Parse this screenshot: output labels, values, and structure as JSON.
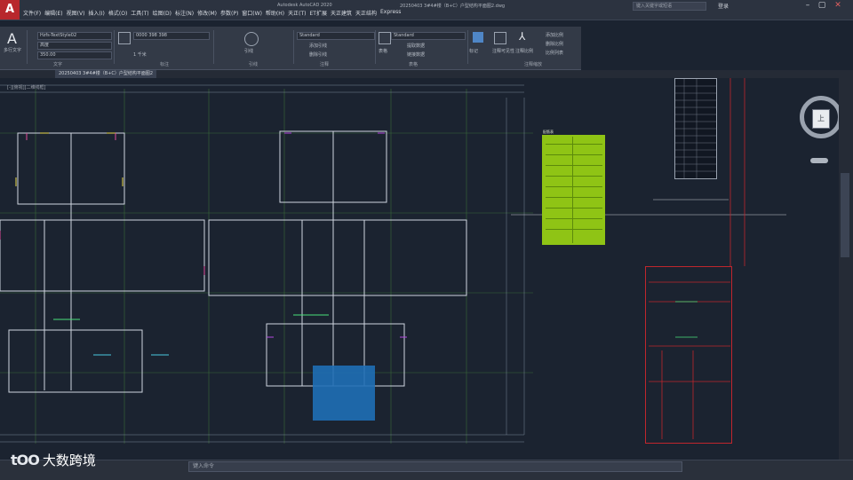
{
  "app": {
    "logo_letter": "A",
    "window_title": "Autodesk AutoCAD 2020",
    "file_title": "20250403 3#4#楼（B+C）户型结构平面图2.dwg",
    "search_placeholder": "键入关键字或短语",
    "user": "登录"
  },
  "menu": [
    "文件(F)",
    "编辑(E)",
    "视图(V)",
    "插入(I)",
    "格式(O)",
    "工具(T)",
    "绘图(D)",
    "标注(N)",
    "修改(M)",
    "参数(P)",
    "窗口(W)",
    "帮助(H)",
    "天正(T)",
    "ET扩展",
    "天正建筑",
    "天正结构",
    "Express"
  ],
  "ribbon": {
    "multiline_text": "多行文字",
    "text_style": "Hzfs-TextStyle02",
    "text_height_label": "高度",
    "text_height": "350.00",
    "layer_value": "0000 398 398",
    "line_label": "1 千米",
    "annotation_label": "注释",
    "style_name": "Standard",
    "table_style": "Standard",
    "panel_text": "文字",
    "panel_dim": "标注",
    "panel_leader": "引线",
    "panel_table": "表格",
    "panel_markup": "标记",
    "panel_annotation_scaling": "注释缩放",
    "btn_add_leader": "添加引线",
    "btn_remove_leader": "删除引线",
    "btn_linear": "线性",
    "btn_leader": "引线",
    "btn_table": "表格",
    "btn_extract": "提取数据",
    "btn_link": "链接数据",
    "btn_add_scale": "添加比例",
    "btn_delete_scale": "删除比例",
    "btn_scale_list": "比例列表",
    "btn_annotation_visibility": "注释可见性",
    "btn_annotation_scale": "注释比例"
  },
  "file_tab": "20250403 3#4#楼（B+C）户型结构平面图2",
  "viewport_label": "[-][俯视][二维线框]",
  "viewcube": {
    "face": "上"
  },
  "green_table": {
    "title": "配筋表"
  },
  "command_placeholder": "键入命令",
  "watermark": {
    "logo": "tOO",
    "text": "大数跨境"
  }
}
